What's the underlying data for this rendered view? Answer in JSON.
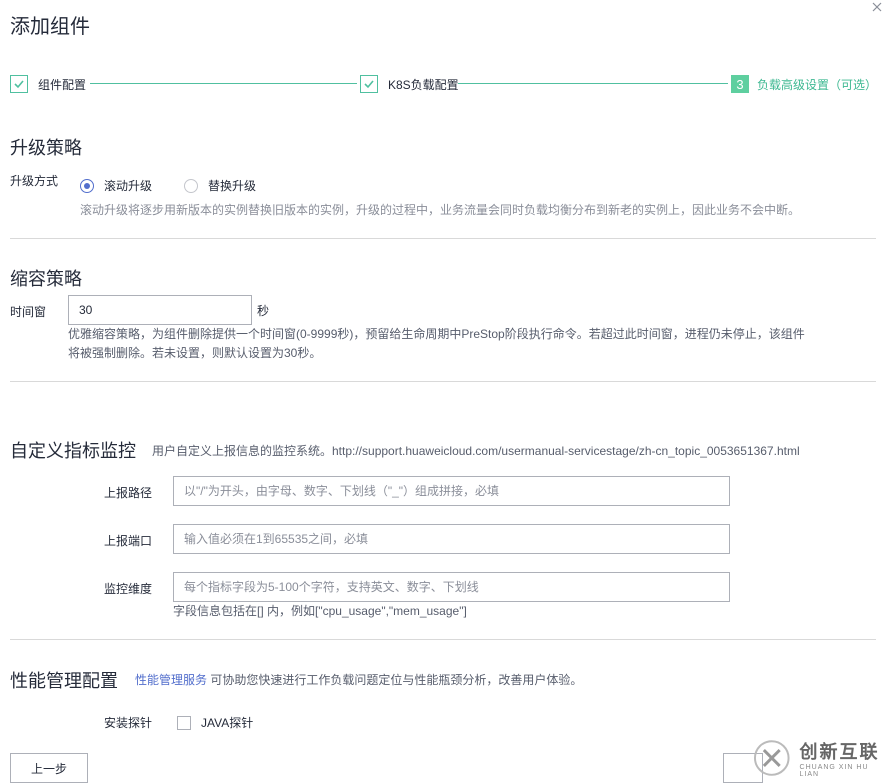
{
  "dialog": {
    "title": "添加组件",
    "close_icon": "close-icon"
  },
  "steps": [
    {
      "label": "组件配置",
      "state": "done"
    },
    {
      "label": "K8S负载配置",
      "state": "done"
    },
    {
      "number": "3",
      "label": "负载高级设置（可选）",
      "state": "active"
    }
  ],
  "colors": {
    "accent_green": "#50c0a0",
    "active_step": "#5ecf9f",
    "link_blue": "#526ecc"
  },
  "upgrade": {
    "title": "升级策略",
    "field_label": "升级方式",
    "options": [
      "滚动升级",
      "替换升级"
    ],
    "selected": "滚动升级",
    "hint": "滚动升级将逐步用新版本的实例替换旧版本的实例，升级的过程中，业务流量会同时负载均衡分布到新老的实例上，因此业务不会中断。"
  },
  "scale_in": {
    "title": "缩容策略",
    "field_label": "时间窗",
    "value": "30",
    "unit": "秒",
    "hint_line1": "优雅缩容策略，为组件删除提供一个时间窗(0-9999秒)，预留给生命周期中PreStop阶段执行命令。若超过此时间窗，进程仍未停止，该组件",
    "hint_line2": "将被强制删除。若未设置，则默认设置为30秒。"
  },
  "custom_metrics": {
    "title": "自定义指标监控",
    "description": "用户自定义上报信息的监控系统。http://support.huaweicloud.com/usermanual-servicestage/zh-cn_topic_0053651367.html",
    "path_label": "上报路径",
    "path_placeholder": "以\"/\"为开头，由字母、数字、下划线（\"_\"）组成拼接，必填",
    "port_label": "上报端口",
    "port_placeholder": "输入值必须在1到65535之间，必填",
    "dimension_label": "监控维度",
    "dimension_placeholder": "每个指标字段为5-100个字符，支持英文、数字、下划线",
    "dimension_hint": "字段信息包括在[] 内，例如[\"cpu_usage\",\"mem_usage\"]"
  },
  "perf": {
    "title": "性能管理配置",
    "link": "性能管理服务",
    "description": " 可协助您快速进行工作负载问题定位与性能瓶颈分析，改善用户体验。",
    "probe_label": "安装探针",
    "probe_option": "JAVA探针"
  },
  "footer": {
    "prev_button": "上一步"
  },
  "watermark": {
    "cn": "创新互联",
    "en": "CHUANG XIN HU LIAN"
  }
}
